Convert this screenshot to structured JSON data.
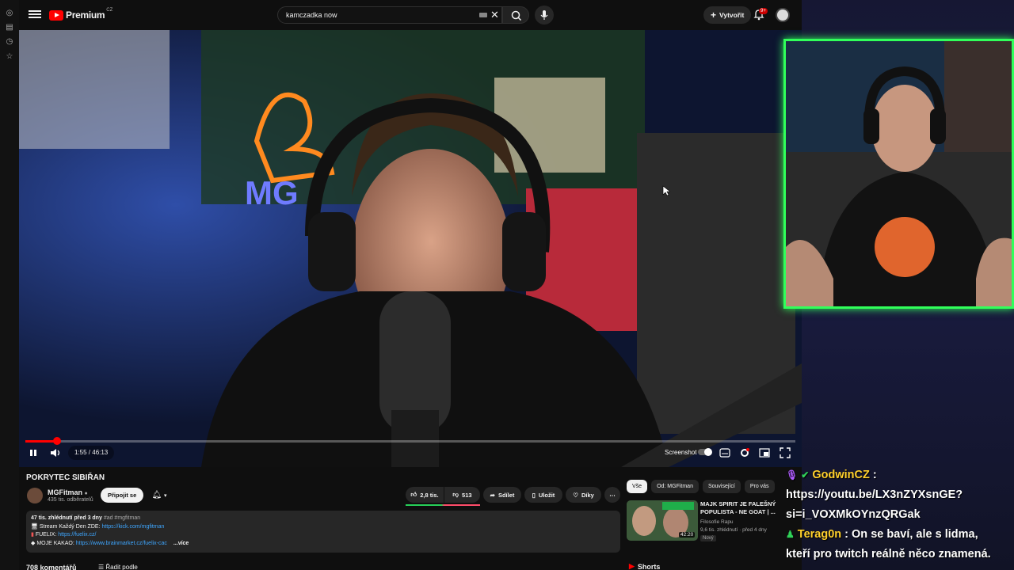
{
  "header": {
    "logo_text": "Premium",
    "logo_country": "CZ",
    "search_value": "kamczadka now",
    "create_label": "Vytvořit",
    "notification_count": "9+"
  },
  "player": {
    "current_time": "1:55",
    "duration": "46:13",
    "time_display": "1:55 / 46:13",
    "progress_fraction": 0.0415,
    "screenshot_label": "Screenshot"
  },
  "video": {
    "title": "POKRYTEC SIBIŘAN",
    "channel_name": "MGFitman",
    "subscribers": "435 tis. odběratelů",
    "join_label": "Připojit se",
    "likes": "2,8 tis.",
    "dislikes": "513",
    "share_label": "Sdílet",
    "save_label": "Uložit",
    "thanks_label": "Díky"
  },
  "description": {
    "meta": "47 tis. zhlédnutí  před 3 dny",
    "tags": "#ad #mgfitman",
    "line1_prefix": "Stream Každý Den ZDE: ",
    "line1_link": "https://kick.com/mgfitman",
    "line2_prefix": "FUELIX: ",
    "line2_link": "https://fuelix.cz/",
    "line3_prefix": "MOJE KAKAO: ",
    "line3_link": "https://www.brainmarket.cz/fuelix-cac",
    "more_label": "...více"
  },
  "comments": {
    "count_label": "708 komentářů",
    "sort_label": "Řadit podle"
  },
  "recommendations": {
    "chips": [
      "Vše",
      "Od: MGFitman",
      "Související",
      "Pro vás"
    ],
    "items": [
      {
        "title": "MAJK SPIRIT JE FALEŠNÝ POPULISTA - NE GOAT | ...",
        "channel": "Filosofie Rapu",
        "meta": "9,6 tis. zhlédnutí · před 4 dny",
        "badge": "Nový",
        "duration": "42:20"
      }
    ],
    "shorts_label": "Shorts"
  },
  "chat": [
    {
      "user": "GodwinCZ",
      "lines": [
        "https://youtu.be/LX3nZYXsnGE?",
        "si=i_VOXMkOYnzQRGak"
      ]
    },
    {
      "user": "Terag0n",
      "lines": [
        "On se baví, ale s lidma,",
        "kteří pro twitch reálně něco znamená."
      ]
    }
  ],
  "colors": {
    "accent": "#ff0000",
    "link": "#3ea6ff",
    "cam_border": "#30ff5a",
    "chat_user": "#ffd02c"
  }
}
